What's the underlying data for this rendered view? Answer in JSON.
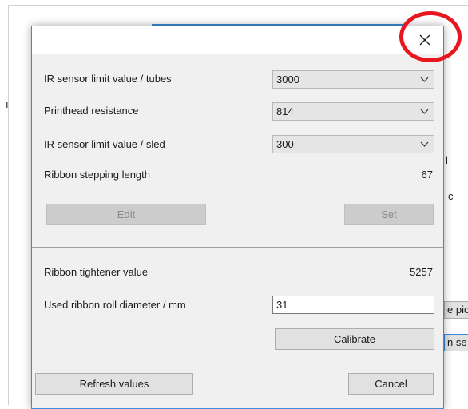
{
  "background": {
    "fragments": [
      "c"
    ],
    "buttons": [
      "e pict",
      "n se"
    ]
  },
  "dialog": {
    "close_icon": "close-icon",
    "rows": {
      "ir_tubes": {
        "label": "IR sensor limit value / tubes",
        "value": "3000"
      },
      "printhead": {
        "label": "Printhead resistance",
        "value": "814"
      },
      "ir_sled": {
        "label": "IR sensor limit value / sled",
        "value": "300"
      },
      "ribbon_step": {
        "label": "Ribbon stepping length",
        "value": "67"
      }
    },
    "buttons": {
      "edit": "Edit",
      "set": "Set",
      "calibrate": "Calibrate",
      "refresh": "Refresh values",
      "cancel": "Cancel"
    },
    "ribbon_tightener": {
      "label": "Ribbon tightener value",
      "value": "5257"
    },
    "roll_diameter": {
      "label": "Used ribbon roll diameter / mm",
      "value": "31"
    }
  },
  "colors": {
    "accent_border": "#3c8ad8",
    "annotation": "#e8161f"
  }
}
